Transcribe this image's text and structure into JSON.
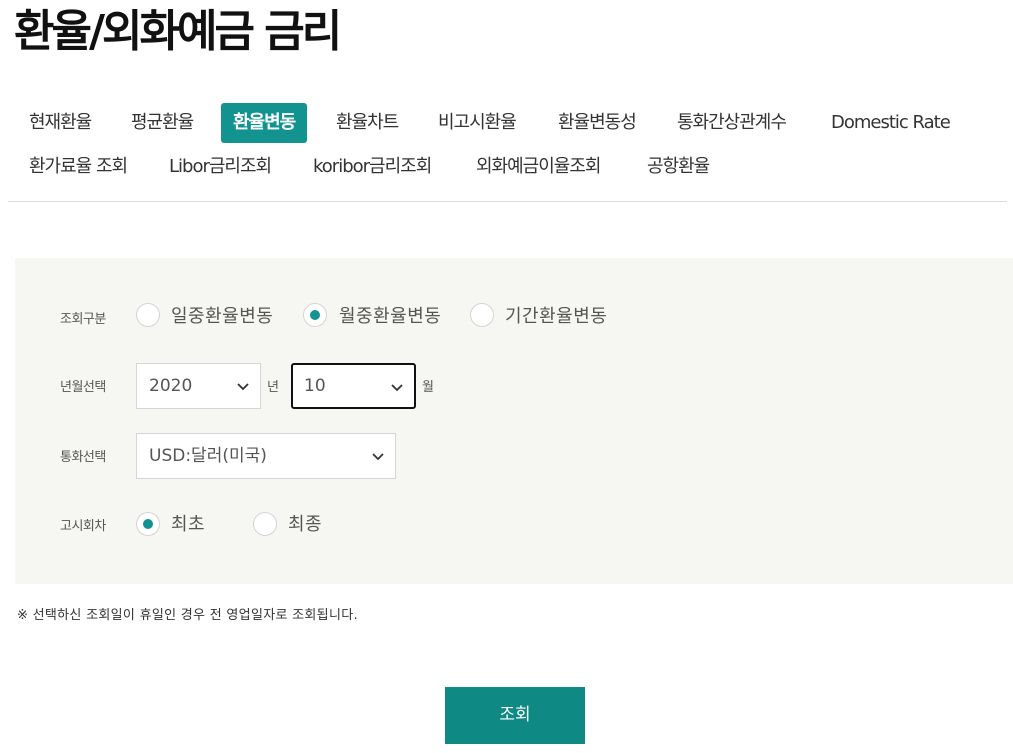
{
  "page": {
    "title": "환율/외화예금 금리"
  },
  "tabs": [
    {
      "label": "현재환율"
    },
    {
      "label": "평균환율"
    },
    {
      "label": "환율변동"
    },
    {
      "label": "환율차트"
    },
    {
      "label": "비고시환율"
    },
    {
      "label": "환율변동성"
    },
    {
      "label": "통화간상관계수"
    },
    {
      "label": "Domestic Rate"
    },
    {
      "label": "환가료율 조회"
    },
    {
      "label": "Libor금리조회"
    },
    {
      "label": "koribor금리조회"
    },
    {
      "label": "외화예금이율조회"
    },
    {
      "label": "공항환율"
    }
  ],
  "active_tab": "환율변동",
  "form": {
    "query_type": {
      "label": "조회구분",
      "options": [
        "일중환율변동",
        "월중환율변동",
        "기간환율변동"
      ],
      "selected": "월중환율변동"
    },
    "year_month": {
      "label": "년월선택",
      "year": "2020",
      "year_unit": "년",
      "month": "10",
      "month_unit": "월"
    },
    "currency": {
      "label": "통화선택",
      "selected": "USD:달러(미국)"
    },
    "notice_round": {
      "label": "고시회차",
      "options": [
        "최초",
        "최종"
      ],
      "selected": "최초"
    }
  },
  "notice": "※ 선택하신 조회일이 휴일인 경우 전 영업일자로 조회됩니다.",
  "search_button": "조회",
  "colors": {
    "accent": "#12938f",
    "button": "#0f8984",
    "panel": "#f6f6f2"
  },
  "icons": {
    "dropdown": "chevron-down-icon"
  }
}
